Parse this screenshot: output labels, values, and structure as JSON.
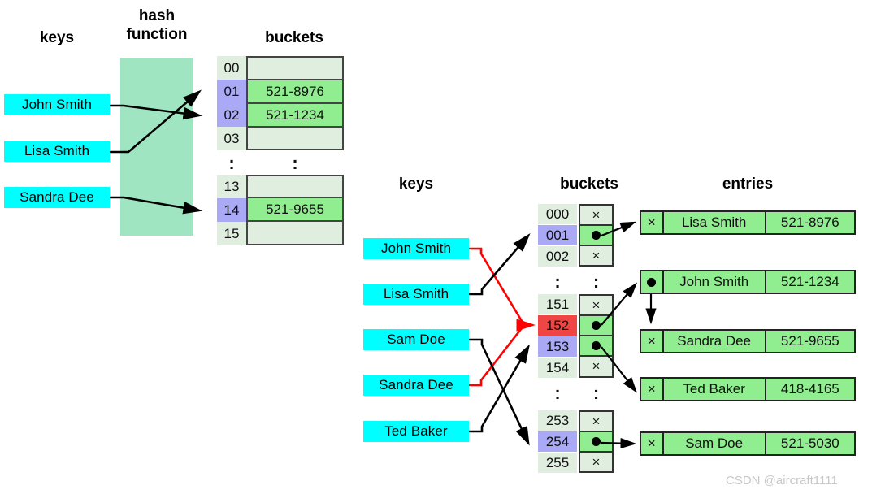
{
  "watermark": "CSDN @aircraft1111",
  "diagram1": {
    "headings": {
      "keys": "keys",
      "hash_function": "hash\nfunction",
      "buckets": "buckets"
    },
    "keys": [
      {
        "label": "John Smith"
      },
      {
        "label": "Lisa Smith"
      },
      {
        "label": "Sandra Dee"
      }
    ],
    "bucket_group_top": [
      {
        "index": "00",
        "value": "",
        "highlight": "none",
        "filled": false
      },
      {
        "index": "01",
        "value": "521-8976",
        "highlight": "blue",
        "filled": true
      },
      {
        "index": "02",
        "value": "521-1234",
        "highlight": "blue",
        "filled": true
      },
      {
        "index": "03",
        "value": "",
        "highlight": "none",
        "filled": false
      }
    ],
    "ellipsis": ":",
    "bucket_group_bottom": [
      {
        "index": "13",
        "value": "",
        "highlight": "none",
        "filled": false
      },
      {
        "index": "14",
        "value": "521-9655",
        "highlight": "blue",
        "filled": true
      },
      {
        "index": "15",
        "value": "",
        "highlight": "none",
        "filled": false
      }
    ]
  },
  "diagram2": {
    "headings": {
      "keys": "keys",
      "buckets": "buckets",
      "entries": "entries"
    },
    "keys": [
      {
        "label": "John Smith"
      },
      {
        "label": "Lisa Smith"
      },
      {
        "label": "Sam Doe"
      },
      {
        "label": "Sandra Dee"
      },
      {
        "label": "Ted Baker"
      }
    ],
    "bucket_group_1": [
      {
        "index": "000",
        "highlight": "none",
        "pointer": "null"
      },
      {
        "index": "001",
        "highlight": "blue",
        "pointer": "dot"
      },
      {
        "index": "002",
        "highlight": "none",
        "pointer": "null"
      }
    ],
    "bucket_group_2": [
      {
        "index": "151",
        "highlight": "none",
        "pointer": "null"
      },
      {
        "index": "152",
        "highlight": "red",
        "pointer": "dot"
      },
      {
        "index": "153",
        "highlight": "blue",
        "pointer": "dot"
      },
      {
        "index": "154",
        "highlight": "none",
        "pointer": "null"
      }
    ],
    "bucket_group_3": [
      {
        "index": "253",
        "highlight": "none",
        "pointer": "null"
      },
      {
        "index": "254",
        "highlight": "blue",
        "pointer": "dot"
      },
      {
        "index": "255",
        "highlight": "none",
        "pointer": "null"
      }
    ],
    "ellipsis": ":",
    "null_glyph": "×",
    "entries": [
      {
        "pointer": "null",
        "name": "Lisa Smith",
        "phone": "521-8976"
      },
      {
        "pointer": "dot",
        "name": "John Smith",
        "phone": "521-1234"
      },
      {
        "pointer": "null",
        "name": "Sandra Dee",
        "phone": "521-9655"
      },
      {
        "pointer": "null",
        "name": "Ted Baker",
        "phone": "418-4165"
      },
      {
        "pointer": "null",
        "name": "Sam Doe",
        "phone": "521-5030"
      }
    ]
  },
  "colors": {
    "key_chip": "#00ffff",
    "hash_panel": "#9fe5c1",
    "bucket_empty": "#dfeedf",
    "bucket_filled": "#90ee90",
    "highlight_blue": "#a9a9f5",
    "highlight_red": "#f04545",
    "link_black": "#000000",
    "link_red": "#ff0000"
  }
}
